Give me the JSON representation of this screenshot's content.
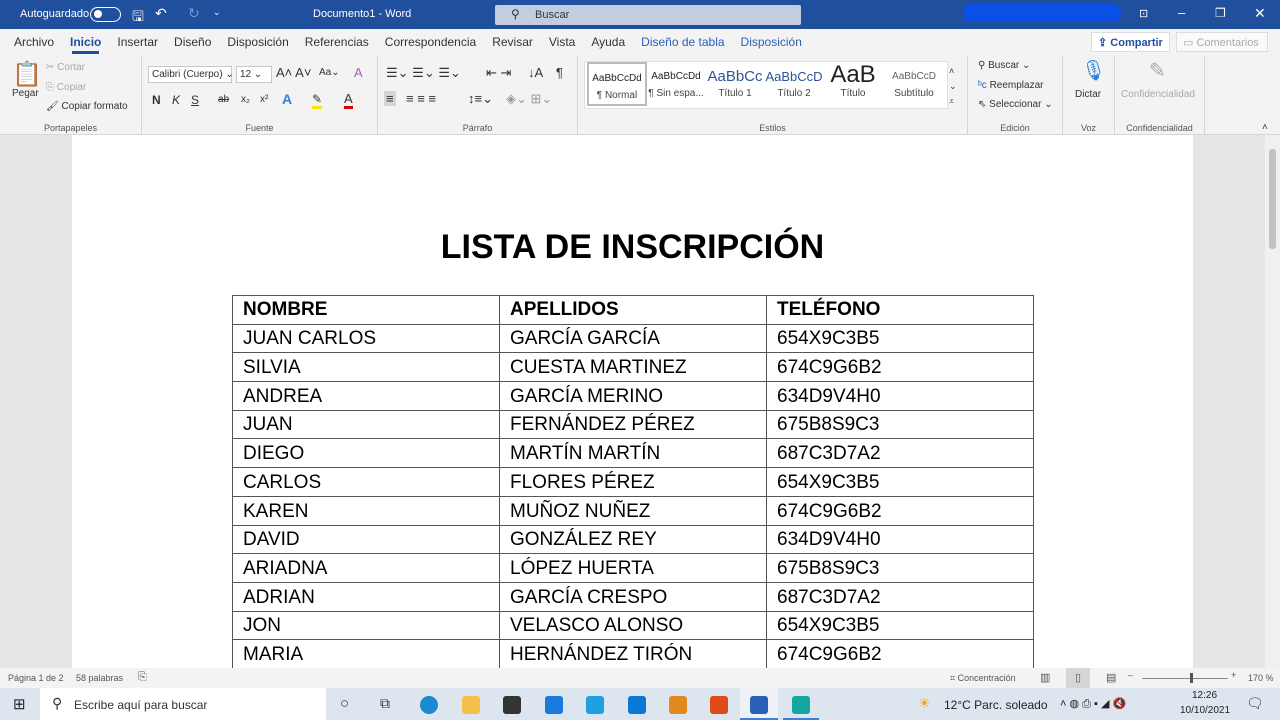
{
  "titlebar": {
    "autosave": "Autoguardado",
    "doc_title": "Documento1 - Word",
    "search": "Buscar"
  },
  "tabs": [
    "Archivo",
    "Inicio",
    "Insertar",
    "Diseño",
    "Disposición",
    "Referencias",
    "Correspondencia",
    "Revisar",
    "Vista",
    "Ayuda",
    "Diseño de tabla",
    "Disposición"
  ],
  "share": "Compartir",
  "comments": "Comentarios",
  "ribbon": {
    "clipboard": {
      "paste": "Pegar",
      "cut": "Cortar",
      "copy": "Copiar",
      "format_painter": "Copiar formato",
      "label": "Portapapeles"
    },
    "font": {
      "name": "Calibri (Cuerpo)",
      "size": "12",
      "bold": "N",
      "italic": "K",
      "underline": "S",
      "label": "Fuente"
    },
    "paragraph": {
      "label": "Párrafo"
    },
    "styles": {
      "items": [
        {
          "preview": "AaBbCcDd",
          "name": "¶ Normal"
        },
        {
          "preview": "AaBbCcDd",
          "name": "¶ Sin espa..."
        },
        {
          "preview": "AaBbCc",
          "name": "Título 1"
        },
        {
          "preview": "AaBbCcD",
          "name": "Título 2"
        },
        {
          "preview": "AaB",
          "name": "Título"
        },
        {
          "preview": "AaBbCcD",
          "name": "Subtítulo"
        }
      ],
      "label": "Estilos"
    },
    "editing": {
      "find": "Buscar",
      "replace": "Reemplazar",
      "select": "Seleccionar",
      "label": "Edición"
    },
    "voice": {
      "dictate": "Dictar",
      "label": "Voz"
    },
    "sensitivity": {
      "button": "Confidencialidad",
      "label": "Confidencialidad"
    }
  },
  "document": {
    "title": "LISTA DE INSCRIPCIÓN",
    "headers": [
      "NOMBRE",
      "APELLIDOS",
      "TELÉFONO"
    ],
    "rows": [
      [
        "JUAN CARLOS",
        "GARCÍA GARCÍA",
        "654X9C3B5"
      ],
      [
        "SILVIA",
        "CUESTA MARTINEZ",
        "674C9G6B2"
      ],
      [
        "ANDREA",
        "GARCÍA MERINO",
        "634D9V4H0"
      ],
      [
        "JUAN",
        "FERNÁNDEZ PÉREZ",
        "675B8S9C3"
      ],
      [
        "DIEGO",
        "MARTÍN MARTÍN",
        "687C3D7A2"
      ],
      [
        "CARLOS",
        "FLORES PÉREZ",
        "654X9C3B5"
      ],
      [
        "KAREN",
        "MUÑOZ NUÑEZ",
        "674C9G6B2"
      ],
      [
        "DAVID",
        "GONZÁLEZ REY",
        "634D9V4H0"
      ],
      [
        "ARIADNA",
        "LÓPEZ HUERTA",
        "675B8S9C3"
      ],
      [
        "ADRIAN",
        "GARCÍA CRESPO",
        "687C3D7A2"
      ],
      [
        "JON",
        "VELASCO ALONSO",
        "654X9C3B5"
      ],
      [
        "MARIA",
        "HERNÁNDEZ TIRÓN",
        "674C9G6B2"
      ]
    ]
  },
  "status": {
    "page": "Página 1 de 2",
    "words": "58 palabras",
    "focus": "Concentración",
    "zoom": "170 %"
  },
  "taskbar": {
    "search_placeholder": "Escribe aquí para buscar",
    "weather": "12°C  Parc. soleado",
    "time": "12:26",
    "date": "10/10/2021"
  },
  "colors": {
    "title_bar": "#1f4f9d",
    "accent": "#2b5fb8"
  }
}
